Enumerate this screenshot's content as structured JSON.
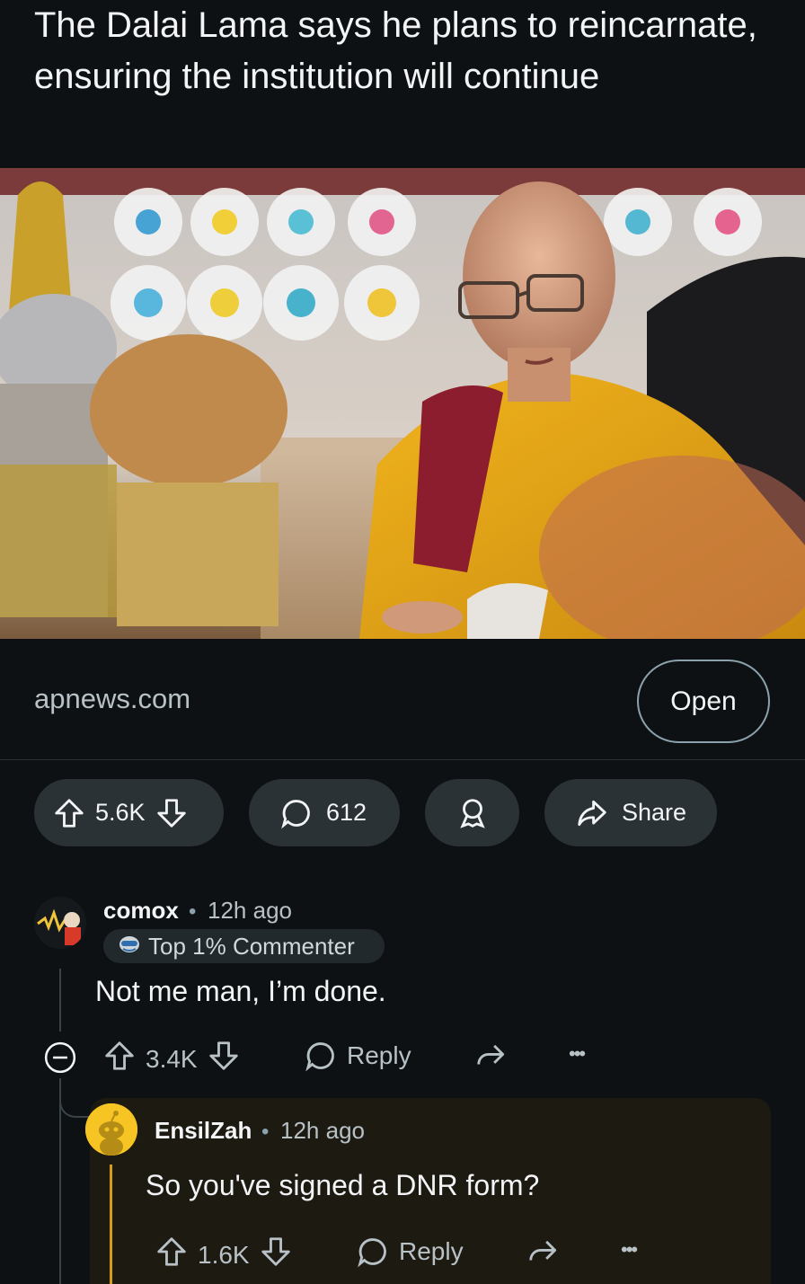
{
  "post": {
    "title": "The Dalai Lama says he plans to reincarnate, ensuring the institution will continue",
    "link_domain": "apnews.com",
    "open_label": "Open",
    "upvotes": "5.6K",
    "comments": "612",
    "share_label": "Share"
  },
  "comments": [
    {
      "author": "comox",
      "separator": "•",
      "time": "12h ago",
      "badge": "Top 1% Commenter",
      "body": "Not me man, I’m done.",
      "votes": "3.4K",
      "reply_label": "Reply",
      "more": "•••"
    },
    {
      "author": "EnsilZah",
      "separator": "•",
      "time": "12h ago",
      "body": "So you've signed a DNR form?",
      "votes": "1.6K",
      "reply_label": "Reply",
      "more": "•••"
    }
  ],
  "colors": {
    "background": "#0e1113",
    "pill": "#2a3236",
    "reply_highlight": "#1d1a12",
    "reply_stripe": "#d49d15",
    "robe": "#e2a21a"
  }
}
